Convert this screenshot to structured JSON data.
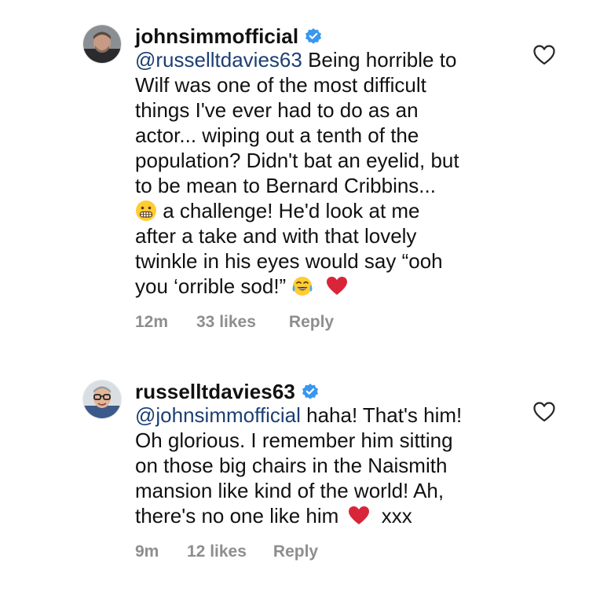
{
  "comments": [
    {
      "username": "johnsimmofficial",
      "verified": true,
      "avatar_icon": "avatar-photo-man-stubble",
      "mention": "@russelltdavies63",
      "lines": [
        "Being horrible to",
        "Wilf was one of the most difficult",
        "things I've ever had to do as an",
        "actor... wiping out a tenth of the",
        "population? Didn't bat an eyelid, but",
        "to be mean to Bernard Cribbins...",
        "a challenge! He'd look at me",
        "after a take and with that lovely",
        "twinkle in his eyes would say “ooh",
        "you ‘orrible sod!”"
      ],
      "time": "12m",
      "likes": "33 likes",
      "reply": "Reply"
    },
    {
      "username": "russelltdavies63",
      "verified": true,
      "avatar_icon": "avatar-photo-man-glasses",
      "mention": "@johnsimmofficial",
      "lines": [
        "haha! That's him!",
        "Oh glorious. I remember him sitting",
        "on those big chairs in the Naismith",
        "mansion like kind of the world! Ah,",
        "there's no one like him",
        "xxx"
      ],
      "time": "9m",
      "likes": "12 likes",
      "reply": "Reply"
    }
  ],
  "colors": {
    "mention": "#1c3f72",
    "verified": "#3897f0",
    "meta": "#8e8e8e",
    "heart": "#d8253a"
  }
}
